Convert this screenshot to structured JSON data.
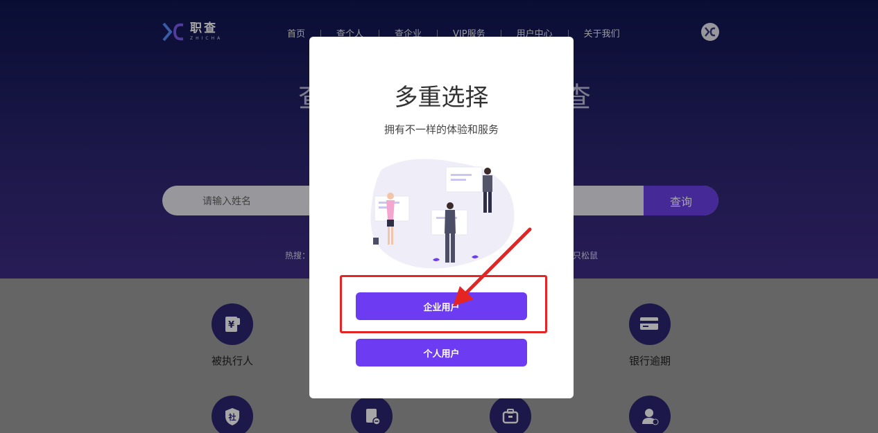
{
  "header": {
    "logo_cn": "职查",
    "logo_en": "ZHICHA",
    "nav": [
      "首页",
      "查个人",
      "查企业",
      "VIP服务",
      "用户中心",
      "关于我们"
    ]
  },
  "hero": {
    "title_left": "查",
    "title_right": "查"
  },
  "search": {
    "placeholder": "请输入姓名",
    "button": "查询",
    "hot_label": "热搜：",
    "hot_tail": "只松鼠"
  },
  "services": {
    "row1": [
      {
        "label": "被执行人",
        "icon": "yen-document-icon"
      },
      {
        "label": "银行逾期",
        "icon": "bank-card-icon"
      }
    ],
    "row2": [
      {
        "icon": "social-security-shield-icon",
        "glyph": "社"
      },
      {
        "icon": "document-minus-icon"
      },
      {
        "icon": "briefcase-icon"
      },
      {
        "icon": "user-edit-icon"
      }
    ]
  },
  "modal": {
    "title": "多重选择",
    "subtitle": "拥有不一样的体验和服务",
    "company_button": "企业用户",
    "personal_button": "个人用户"
  },
  "colors": {
    "brand_purple": "#6d3cf2",
    "hero_dark": "#0f1550",
    "annotation_red": "#e52424"
  }
}
